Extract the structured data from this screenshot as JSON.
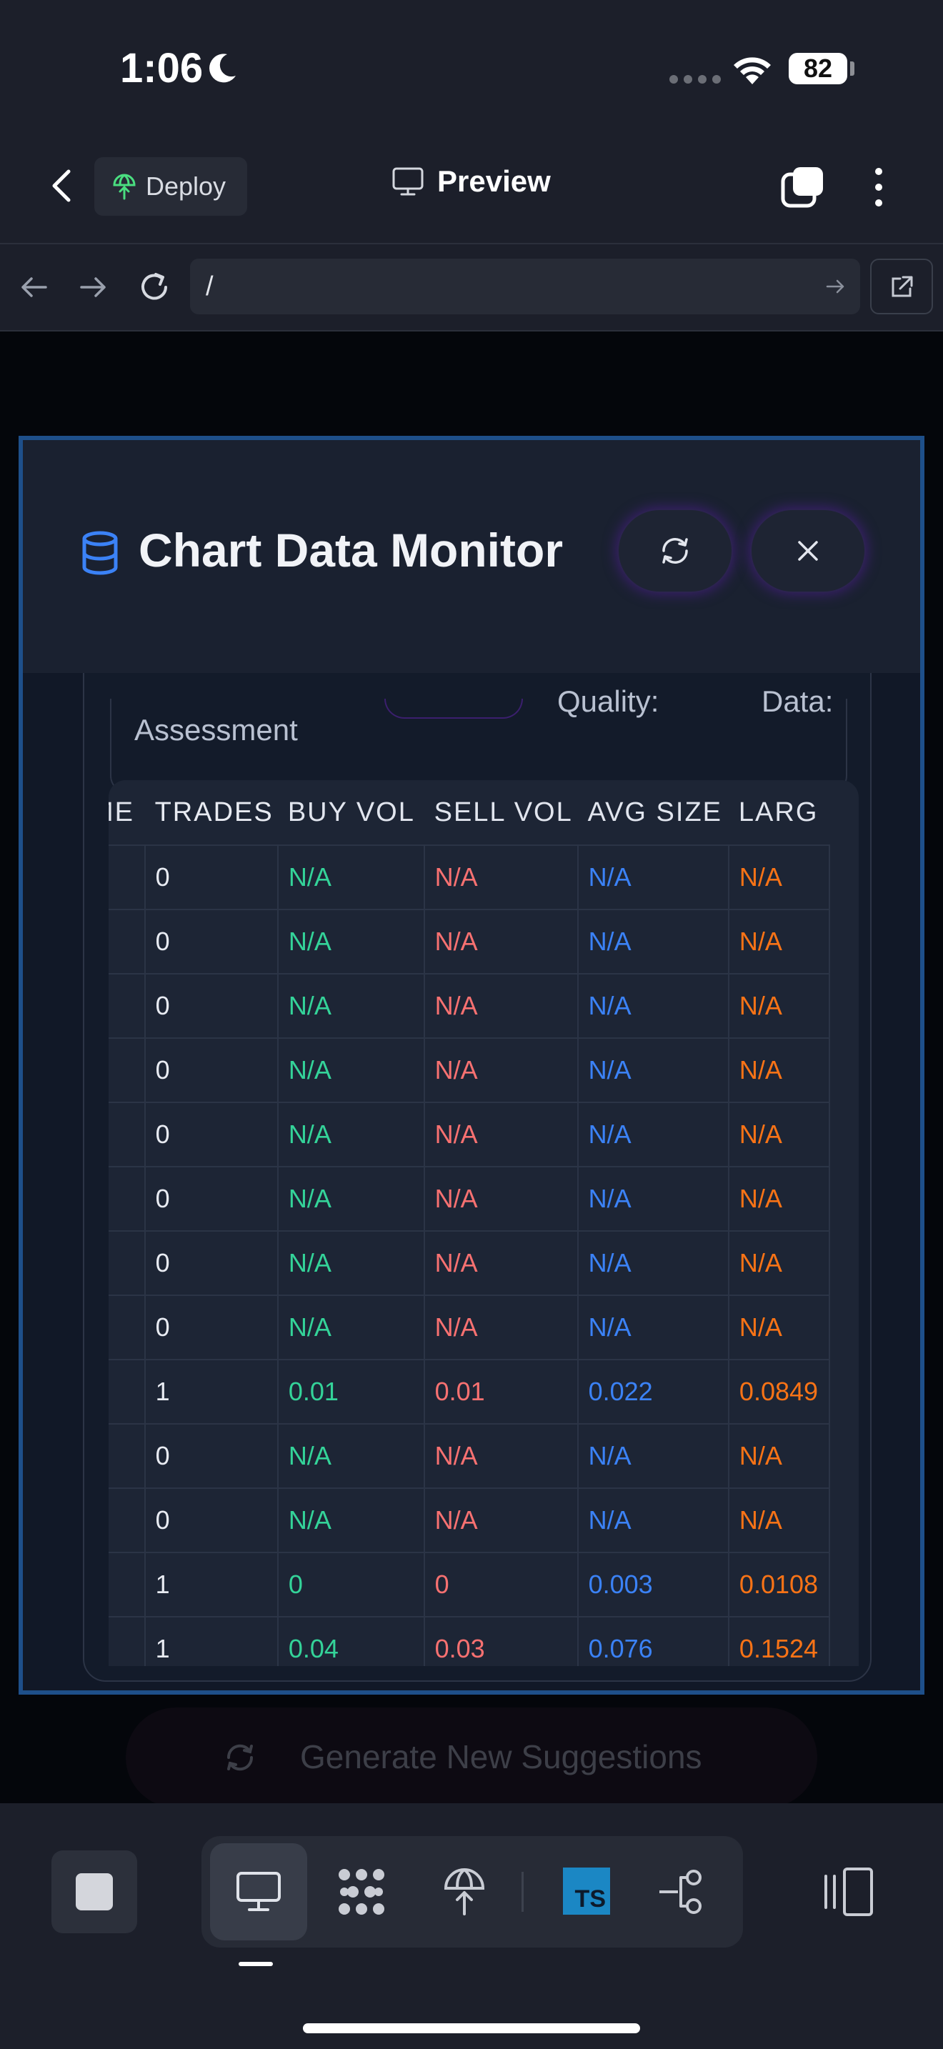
{
  "status_bar": {
    "time": "1:06",
    "battery": "82"
  },
  "app_bar": {
    "deploy_label": "Deploy",
    "preview_label": "Preview"
  },
  "browser": {
    "url": "/"
  },
  "background": {
    "generate_label": "Generate New Suggestions"
  },
  "modal": {
    "title": "Chart Data Monitor",
    "summary_left": "Assessment",
    "summary_mid": "Quality:",
    "summary_right": "Data:"
  },
  "table": {
    "headers": [
      "ME",
      "TRADES",
      "BUY VOL",
      "SELL VOL",
      "AVG SIZE",
      "LARG"
    ],
    "rows": [
      [
        "",
        "0",
        "N/A",
        "N/A",
        "N/A",
        "N/A"
      ],
      [
        "",
        "0",
        "N/A",
        "N/A",
        "N/A",
        "N/A"
      ],
      [
        "",
        "0",
        "N/A",
        "N/A",
        "N/A",
        "N/A"
      ],
      [
        "",
        "0",
        "N/A",
        "N/A",
        "N/A",
        "N/A"
      ],
      [
        "",
        "0",
        "N/A",
        "N/A",
        "N/A",
        "N/A"
      ],
      [
        "",
        "0",
        "N/A",
        "N/A",
        "N/A",
        "N/A"
      ],
      [
        "",
        "0",
        "N/A",
        "N/A",
        "N/A",
        "N/A"
      ],
      [
        "",
        "0",
        "N/A",
        "N/A",
        "N/A",
        "N/A"
      ],
      [
        "",
        "1",
        "0.01",
        "0.01",
        "0.022",
        "0.0849"
      ],
      [
        "",
        "0",
        "N/A",
        "N/A",
        "N/A",
        "N/A"
      ],
      [
        "",
        "0",
        "N/A",
        "N/A",
        "N/A",
        "N/A"
      ],
      [
        "",
        "1",
        "0",
        "0",
        "0.003",
        "0.0108"
      ],
      [
        "",
        "1",
        "0.04",
        "0.03",
        "0.076",
        "0.1524"
      ]
    ]
  },
  "toolbar": {
    "ts_badge": "TS"
  },
  "colors": {
    "buy": "#34d399",
    "sell": "#f87171",
    "avg": "#3b82f6",
    "largest": "#f97316",
    "modal_border": "#1e4f8a",
    "accent_glow": "#3b1f6e"
  },
  "icons": [
    "moon-icon",
    "wifi-icon",
    "back-chevron-icon",
    "deploy-globe-icon",
    "monitor-icon",
    "tabs-icon",
    "more-vertical-icon",
    "arrow-left-icon",
    "arrow-right-icon",
    "reload-icon",
    "external-link-icon",
    "database-icon",
    "refresh-icon",
    "close-icon",
    "stop-icon",
    "desktop-icon",
    "grid-dots-icon",
    "deploy-icon",
    "typescript-icon",
    "git-branch-icon",
    "sidebar-toggle-icon"
  ]
}
